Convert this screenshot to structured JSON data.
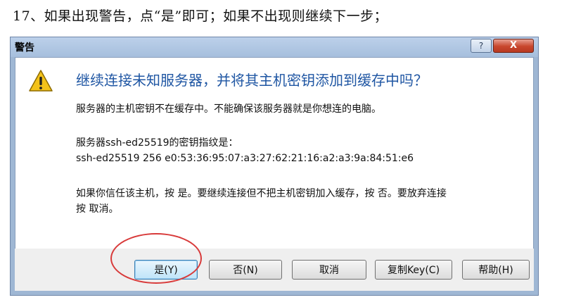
{
  "caption": "17、如果出现警告，点“是”即可；如果不出现则继续下一步；",
  "dialog": {
    "title": "警告",
    "help_label": "?",
    "close_label": "X",
    "headline": "继续连接未知服务器，并将其主机密钥添加到缓存中吗？",
    "para1": "服务器的主机密钥不在缓存中。不能确保该服务器就是你想连的电脑。",
    "para2_line1": "服务器ssh-ed25519的密钥指纹是：",
    "para2_line2": "ssh-ed25519 256 e0:53:36:95:07:a3:27:62:21:16:a2:a3:9a:84:51:e6",
    "para3_line1": "如果你信任该主机，按 是。要继续连接但不把主机密钥加入缓存，按 否。要放弃连接",
    "para3_line2": "按 取消。",
    "buttons": {
      "yes": "是(Y)",
      "no": "否(N)",
      "cancel": "取消",
      "copy_key": "复制Key(C)",
      "help": "帮助(H)"
    }
  },
  "icons": {
    "warning": "warning-icon",
    "help": "help-icon",
    "close": "close-icon"
  },
  "colors": {
    "headline": "#1f56a3",
    "highlight_ellipse": "#d83a3a",
    "close_button": "#c8462d"
  }
}
